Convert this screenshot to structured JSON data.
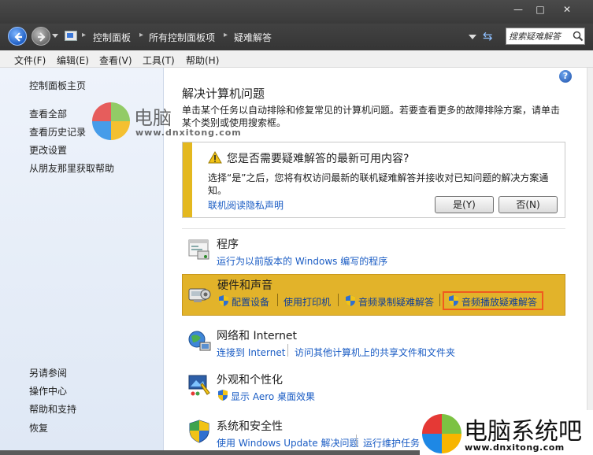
{
  "window": {
    "minimize": "—",
    "maximize": "□",
    "close": "✕"
  },
  "address": {
    "crumbs": [
      "控制面板",
      "所有控制面板项",
      "疑难解答"
    ],
    "search_placeholder": "搜索疑难解答"
  },
  "menu": [
    "文件(F)",
    "编辑(E)",
    "查看(V)",
    "工具(T)",
    "帮助(H)"
  ],
  "sidebar": {
    "home": "控制面板主页",
    "links": [
      "查看全部",
      "查看历史记录",
      "更改设置",
      "从朋友那里获取帮助"
    ],
    "see_also": [
      "另请参阅",
      "操作中心",
      "帮助和支持",
      "恢复"
    ]
  },
  "main": {
    "title": "解决计算机问题",
    "description": "单击某个任务以自动排除和修复常见的计算机问题。若要查看更多的故障排除方案，请单击某个类别或使用搜索框。",
    "notice": {
      "title": "您是否需要疑难解答的最新可用内容?",
      "text": "选择“是”之后，您将有权访问最新的联机疑难解答并接收对已知问题的解决方案通知。",
      "privacy_link": "联机阅读隐私声明",
      "yes": "是(Y)",
      "no": "否(N)"
    },
    "categories": [
      {
        "title": "程序",
        "links": [
          "运行为以前版本的 Windows 编写的程序"
        ]
      },
      {
        "title": "硬件和声音",
        "links": [
          "配置设备",
          "使用打印机",
          "音频录制疑难解答",
          "音频播放疑难解答"
        ]
      },
      {
        "title": "网络和 Internet",
        "links": [
          "连接到 Internet",
          "访问其他计算机上的共享文件和文件夹"
        ]
      },
      {
        "title": "外观和个性化",
        "links": [
          "显示 Aero 桌面效果"
        ]
      },
      {
        "title": "系统和安全性",
        "links": [
          "使用 Windows Update 解决问题",
          "运行维护任务"
        ]
      }
    ]
  },
  "watermark": {
    "name_top": "电脑",
    "url_top": "www.dnxitong.com",
    "name_bottom": "电脑系统吧",
    "url_bottom": "www.dnxitong.com"
  },
  "colors": {
    "accent_link": "#1a5cc4",
    "highlight": "#e2b32a",
    "focus_box": "#f05a1e"
  }
}
